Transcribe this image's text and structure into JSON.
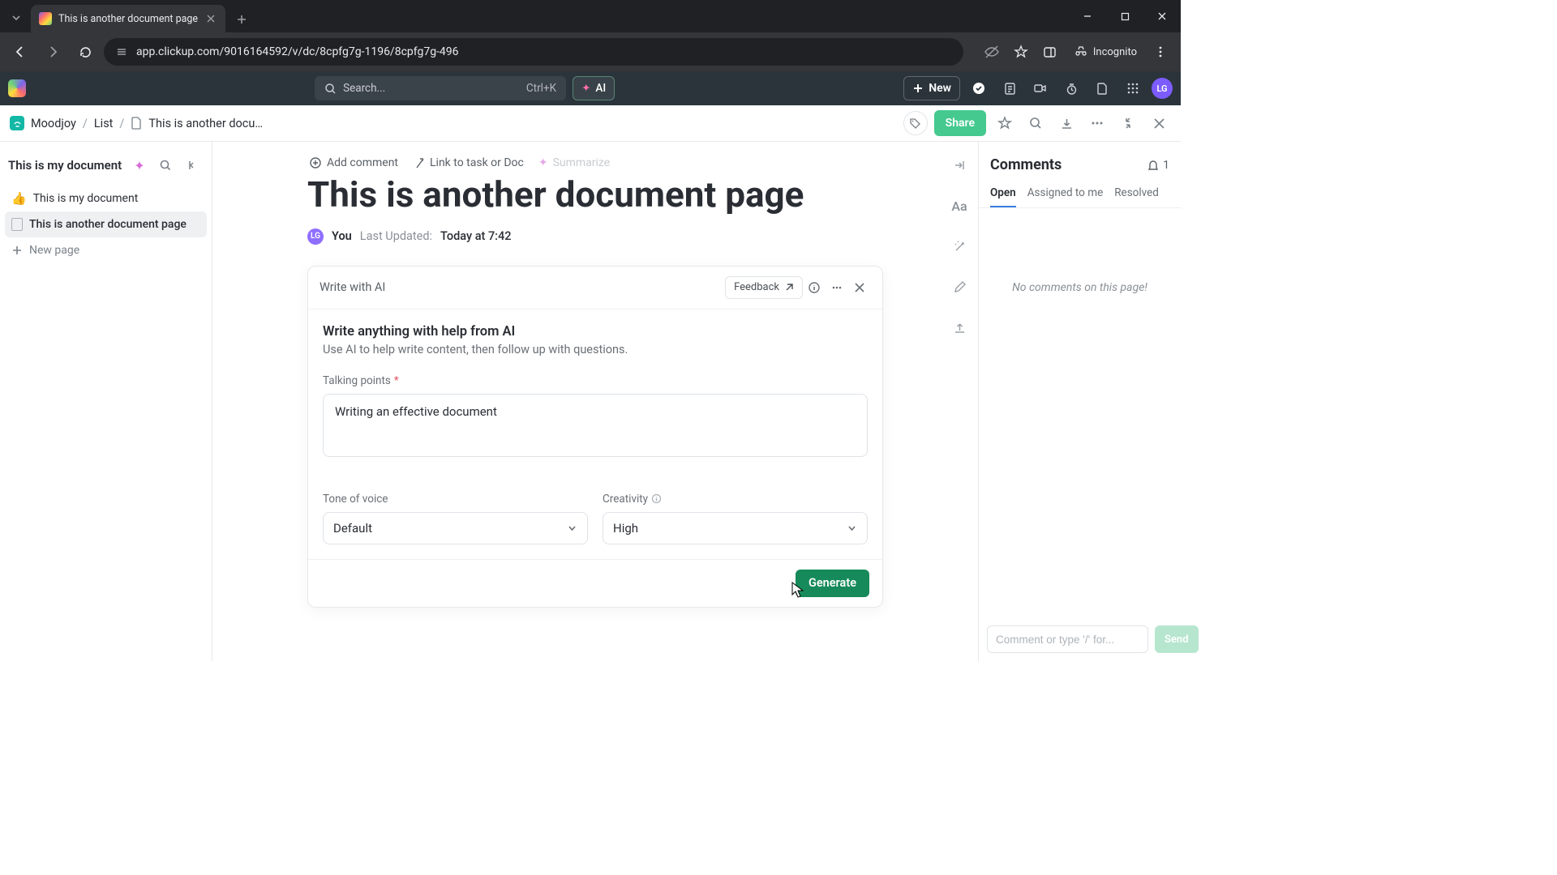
{
  "browser": {
    "tab_title": "This is another document page",
    "url": "app.clickup.com/9016164592/v/dc/8cpfg7g-1196/8cpfg7g-496",
    "incognito_label": "Incognito"
  },
  "app_header": {
    "search_placeholder": "Search...",
    "search_kbd": "Ctrl+K",
    "ai_label": "AI",
    "new_label": "New",
    "avatar_initials": "LG"
  },
  "breadcrumb": {
    "workspace": "Moodjoy",
    "list": "List",
    "page": "This is another docu…",
    "share_label": "Share"
  },
  "sidebar": {
    "doc_title": "This is my document",
    "pages": [
      {
        "emoji": "👍",
        "label": "This is my document"
      },
      {
        "label": "This is another document page"
      }
    ],
    "new_page_label": "New page"
  },
  "document": {
    "actions": {
      "add_comment": "Add comment",
      "link_task": "Link to task or Doc",
      "summarize": "Summarize"
    },
    "title": "This is another document page",
    "author_initials": "LG",
    "author_label": "You",
    "updated_label": "Last Updated:",
    "updated_value": "Today at 7:42"
  },
  "ai_panel": {
    "header": "Write with AI",
    "feedback": "Feedback",
    "heading": "Write anything with help from AI",
    "sub": "Use AI to help write content, then follow up with questions.",
    "talking_label": "Talking points",
    "talking_value": "Writing an effective document",
    "tone_label": "Tone of voice",
    "tone_value": "Default",
    "creativity_label": "Creativity",
    "creativity_value": "High",
    "generate": "Generate"
  },
  "comments": {
    "title": "Comments",
    "badge_count": "1",
    "tabs": {
      "open": "Open",
      "assigned": "Assigned to me",
      "resolved": "Resolved"
    },
    "empty": "No comments on this page!",
    "placeholder": "Comment or type '/' for...",
    "send": "Send"
  }
}
